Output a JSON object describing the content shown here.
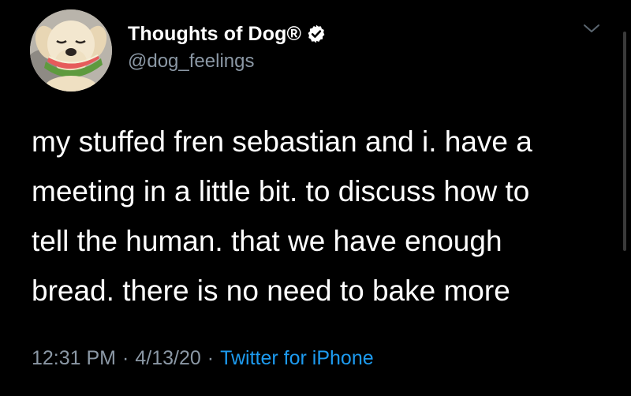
{
  "author": {
    "display_name": "Thoughts of Dog®",
    "handle": "@dog_feelings",
    "avatar_icon": "dog-with-watermelon-avatar",
    "verified_icon": "verified-badge-icon"
  },
  "tweet": {
    "lines": [
      "my stuffed fren sebastian and i. have a",
      "meeting in a little bit. to discuss how to",
      "tell the human. that we have enough",
      "bread. there is no need to bake more"
    ]
  },
  "meta": {
    "time": "12:31 PM",
    "separator": "·",
    "date": "4/13/20",
    "source": "Twitter for iPhone"
  },
  "menu_icon": "chevron-down-icon",
  "colors": {
    "background": "#000000",
    "text": "#ffffff",
    "secondary_text": "#8b98a5",
    "link": "#1d9bf0"
  }
}
